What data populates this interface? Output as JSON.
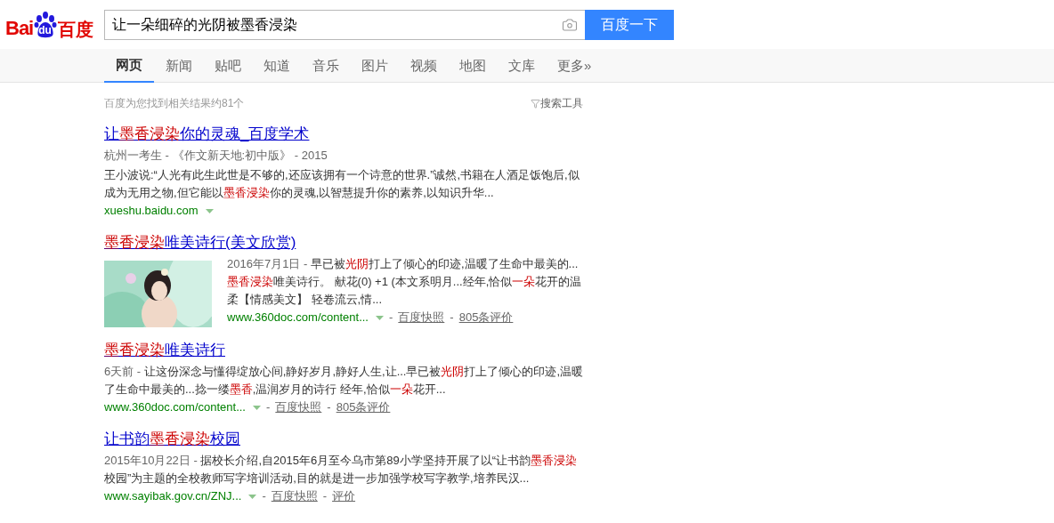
{
  "logo": {
    "part_1": "Bai",
    "part_2": "du",
    "part_3": "百度"
  },
  "search": {
    "value": "让一朵细碎的光阴被墨香浸染",
    "button": "百度一下"
  },
  "tabs": [
    {
      "label": "网页",
      "selected": true
    },
    {
      "label": "新闻",
      "selected": false
    },
    {
      "label": "贴吧",
      "selected": false
    },
    {
      "label": "知道",
      "selected": false
    },
    {
      "label": "音乐",
      "selected": false
    },
    {
      "label": "图片",
      "selected": false
    },
    {
      "label": "视频",
      "selected": false
    },
    {
      "label": "地图",
      "selected": false
    },
    {
      "label": "文库",
      "selected": false
    },
    {
      "label": "更多»",
      "selected": false
    }
  ],
  "result_count": "百度为您找到相关结果约81个",
  "search_tools": "搜索工具",
  "separator": "-",
  "results": [
    {
      "title": [
        {
          "text": "让",
          "hl": false
        },
        {
          "text": "墨香浸染",
          "hl": true
        },
        {
          "text": "你的灵魂_百度学术",
          "hl": false
        }
      ],
      "source": "杭州一考生 - 《作文新天地:初中版》 - 2015",
      "snippet": [
        {
          "text": "王小波说:“人光有此生此世是不够的,还应该拥有一个诗意的世界.”诚然,书籍在人酒足饭饱后,似成为无用之物,但它能以",
          "hl": false
        },
        {
          "text": "墨香浸染",
          "hl": true
        },
        {
          "text": "你的灵魂,以智慧提升你的素养,以知识升华...",
          "hl": false
        }
      ],
      "url": "xueshu.baidu.com"
    },
    {
      "title": [
        {
          "text": "墨香浸染",
          "hl": true
        },
        {
          "text": "唯美诗行(美文欣赏)",
          "hl": false
        }
      ],
      "thumbnail": {
        "kind": "picture"
      },
      "date": "2016年7月1日 -",
      "snippet": [
        {
          "text": "早已被",
          "hl": false
        },
        {
          "text": "光阴",
          "hl": true
        },
        {
          "text": "打上了倾心的印迹,温暖了生命中最美的...",
          "hl": false
        },
        {
          "text": "墨香浸染",
          "hl": true
        },
        {
          "text": "唯美诗行。 献花(0) +1 (本文系明月...经年,恰似",
          "hl": false
        },
        {
          "text": "一朵",
          "hl": true
        },
        {
          "text": "花开的温柔【情感美文】 轻卷流云,情...",
          "hl": false
        }
      ],
      "url": "www.360doc.com/content...",
      "snapshot": "百度快照",
      "reviews": "805条评价"
    },
    {
      "title": [
        {
          "text": "墨香浸染",
          "hl": true
        },
        {
          "text": "唯美诗行",
          "hl": false
        }
      ],
      "date": "6天前 -",
      "snippet": [
        {
          "text": "让这份深念与懂得绽放心间,静好岁月,静好人生,让...早已被",
          "hl": false
        },
        {
          "text": "光阴",
          "hl": true
        },
        {
          "text": "打上了倾心的印迹,温暖了生命中最美的...捻一缕",
          "hl": false
        },
        {
          "text": "墨香",
          "hl": true
        },
        {
          "text": ",温润岁月的诗行 经年,恰似",
          "hl": false
        },
        {
          "text": "一朵",
          "hl": true
        },
        {
          "text": "花开...",
          "hl": false
        }
      ],
      "url": "www.360doc.com/content...",
      "snapshot": "百度快照",
      "reviews": "805条评价"
    },
    {
      "title": [
        {
          "text": "让书韵",
          "hl": false
        },
        {
          "text": "墨香浸染",
          "hl": true
        },
        {
          "text": "校园",
          "hl": false
        }
      ],
      "date": "2015年10月22日 -",
      "snippet": [
        {
          "text": "据校长介绍,自2015年6月至今乌市第89小学坚持开展了以“让书韵",
          "hl": false
        },
        {
          "text": "墨香浸染",
          "hl": true
        },
        {
          "text": "校园”为主题的全校教师写字培训活动,目的就是进一步加强学校写字教学,培养民汉...",
          "hl": false
        }
      ],
      "url": "www.sayibak.gov.cn/ZNJ...",
      "snapshot": "百度快照",
      "reviews": "评价"
    }
  ]
}
